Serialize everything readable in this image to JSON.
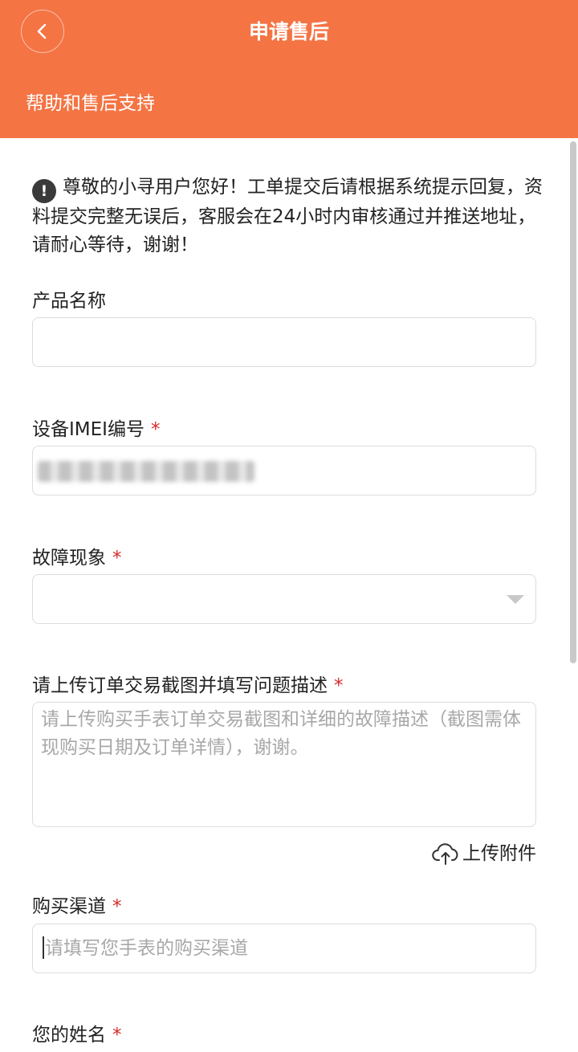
{
  "header": {
    "title": "申请售后",
    "subtitle": "帮助和售后支持",
    "background_color": "#F47444",
    "back_icon": "chevron-left-icon"
  },
  "notice": {
    "icon": "exclamation-circle-icon",
    "icon_glyph": "!",
    "text": "尊敬的小寻用户您好！工单提交后请根据系统提示回复，资料提交完整无误后，客服会在24小时内审核通过并推送地址，请耐心等待，谢谢！"
  },
  "form": {
    "required_mark": "*",
    "product_name": {
      "label": "产品名称",
      "value": ""
    },
    "imei": {
      "label": "设备IMEI编号",
      "value": ""
    },
    "fault": {
      "label": "故障现象",
      "selected": ""
    },
    "description": {
      "label": "请上传订单交易截图并填写问题描述",
      "placeholder": "请上传购买手表订单交易截图和详细的故障描述（截图需体现购买日期及订单详情），谢谢。"
    },
    "upload": {
      "label": "上传附件",
      "icon": "cloud-upload-icon"
    },
    "channel": {
      "label": "购买渠道",
      "placeholder": "请填写您手表的购买渠道"
    },
    "name": {
      "label": "您的姓名"
    }
  }
}
